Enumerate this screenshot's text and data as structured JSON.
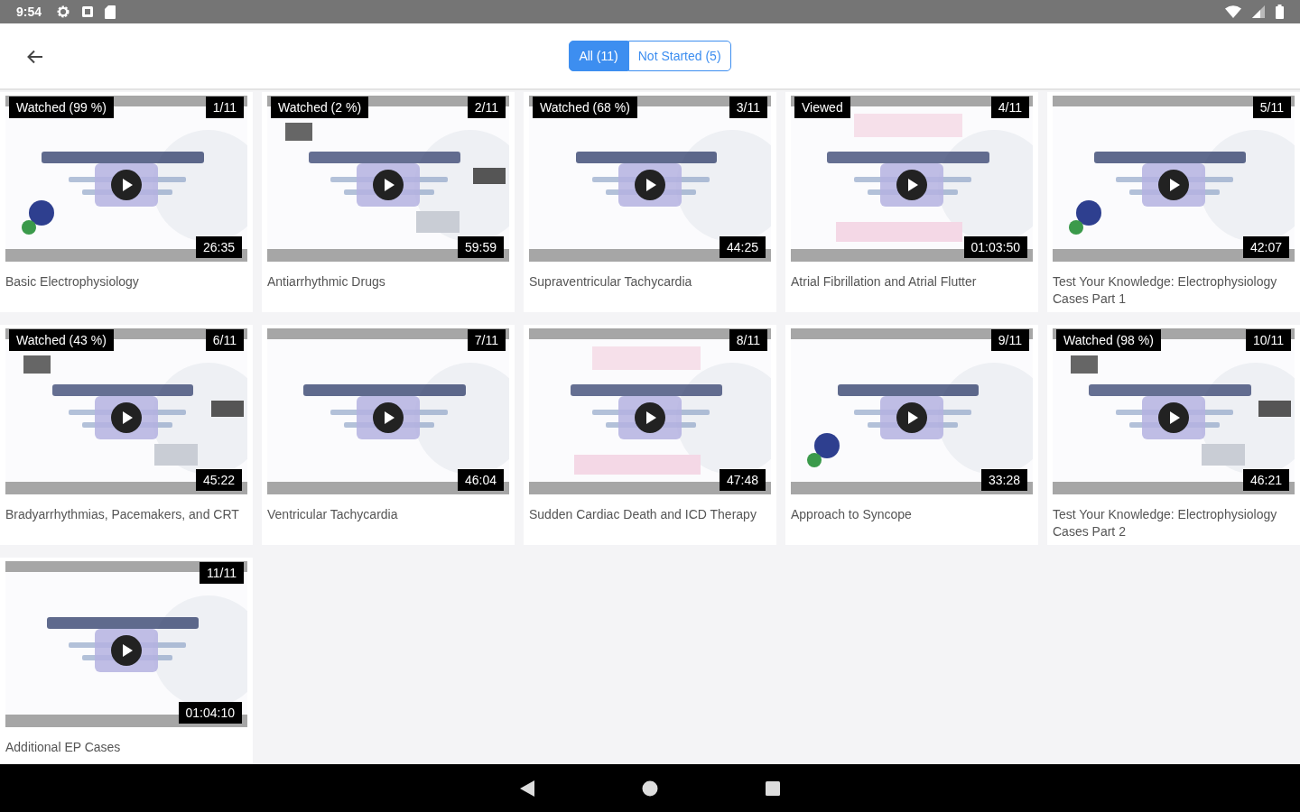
{
  "status_bar": {
    "time": "9:54"
  },
  "filters": [
    {
      "label": "All (11)",
      "selected": true
    },
    {
      "label": "Not Started (5)",
      "selected": false
    }
  ],
  "videos": [
    {
      "status": "Watched (99 %)",
      "index": "1/11",
      "duration": "26:35",
      "title": "Basic Electrophysiology"
    },
    {
      "status": "Watched (2 %)",
      "index": "2/11",
      "duration": "59:59",
      "title": "Antiarrhythmic Drugs"
    },
    {
      "status": "Watched (68 %)",
      "index": "3/11",
      "duration": "44:25",
      "title": "Supraventricular Tachycardia"
    },
    {
      "status": "Viewed",
      "index": "4/11",
      "duration": "01:03:50",
      "title": "Atrial Fibrillation and Atrial Flutter"
    },
    {
      "index": "5/11",
      "duration": "42:07",
      "title": "Test Your Knowledge: Electrophysiology Cases Part 1"
    },
    {
      "status": "Watched (43 %)",
      "index": "6/11",
      "duration": "45:22",
      "title": "Bradyarrhythmias, Pacemakers, and CRT"
    },
    {
      "index": "7/11",
      "duration": "46:04",
      "title": "Ventricular Tachycardia"
    },
    {
      "index": "8/11",
      "duration": "47:48",
      "title": "Sudden Cardiac Death and ICD Therapy"
    },
    {
      "index": "9/11",
      "duration": "33:28",
      "title": "Approach to Syncope"
    },
    {
      "status": "Watched (98 %)",
      "index": "10/11",
      "duration": "46:21",
      "title": "Test Your Knowledge: Electrophysiology Cases Part 2"
    },
    {
      "index": "11/11",
      "duration": "01:04:10",
      "title": "Additional EP Cases"
    }
  ]
}
